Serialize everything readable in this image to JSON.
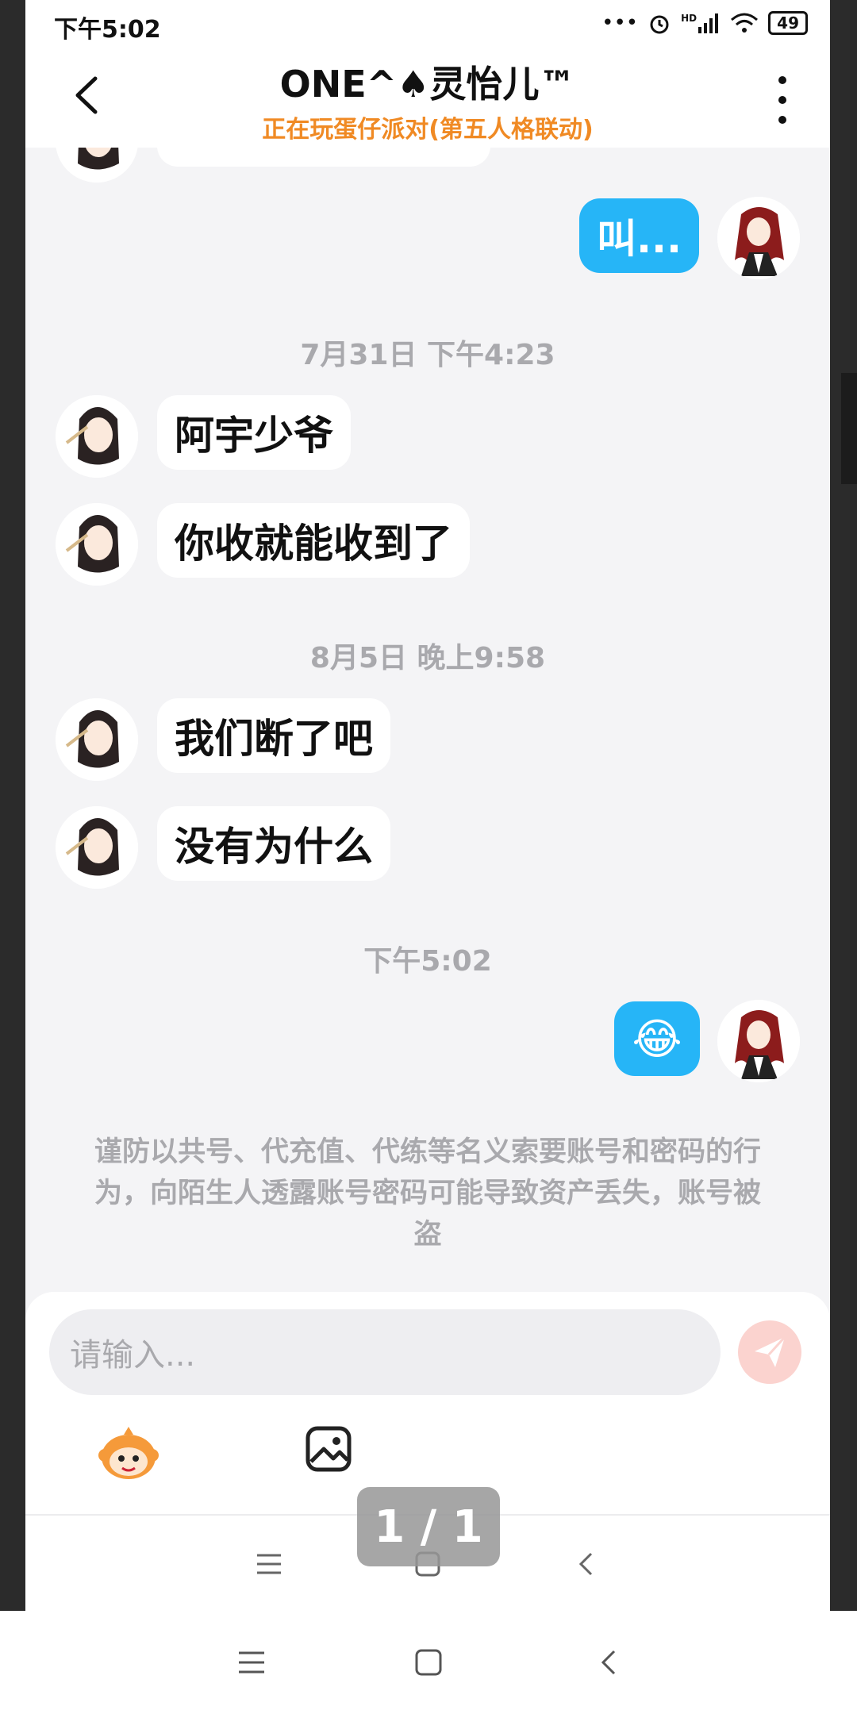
{
  "status_bar": {
    "time": "下午5:02",
    "more": "•••",
    "network_label": "HD",
    "battery": "49"
  },
  "header": {
    "title": "ONE^♠灵怡儿™",
    "subtitle": "正在玩蛋仔派对(第五人格联动)"
  },
  "messages": {
    "top_out": "叫...",
    "sep1": "7月31日 下午4:23",
    "m1": "阿宇少爷",
    "m2": "你收就能收到了",
    "sep2": "8月5日 晚上9:58",
    "m3": "我们断了吧",
    "m4": "没有为什么",
    "sep3": "下午5:02",
    "emoji_out": "😂"
  },
  "notice": "谨防以共号、代充值、代练等名义索要账号和密码的行为，向陌生人透露账号密码可能导致资产丢失，账号被盗",
  "input": {
    "placeholder": "请输入..."
  },
  "page_indicator": "1 / 1",
  "colors": {
    "accent_orange": "#f08a24",
    "bubble_blue": "#26b5f7",
    "send_disabled": "#fbd3cf"
  }
}
